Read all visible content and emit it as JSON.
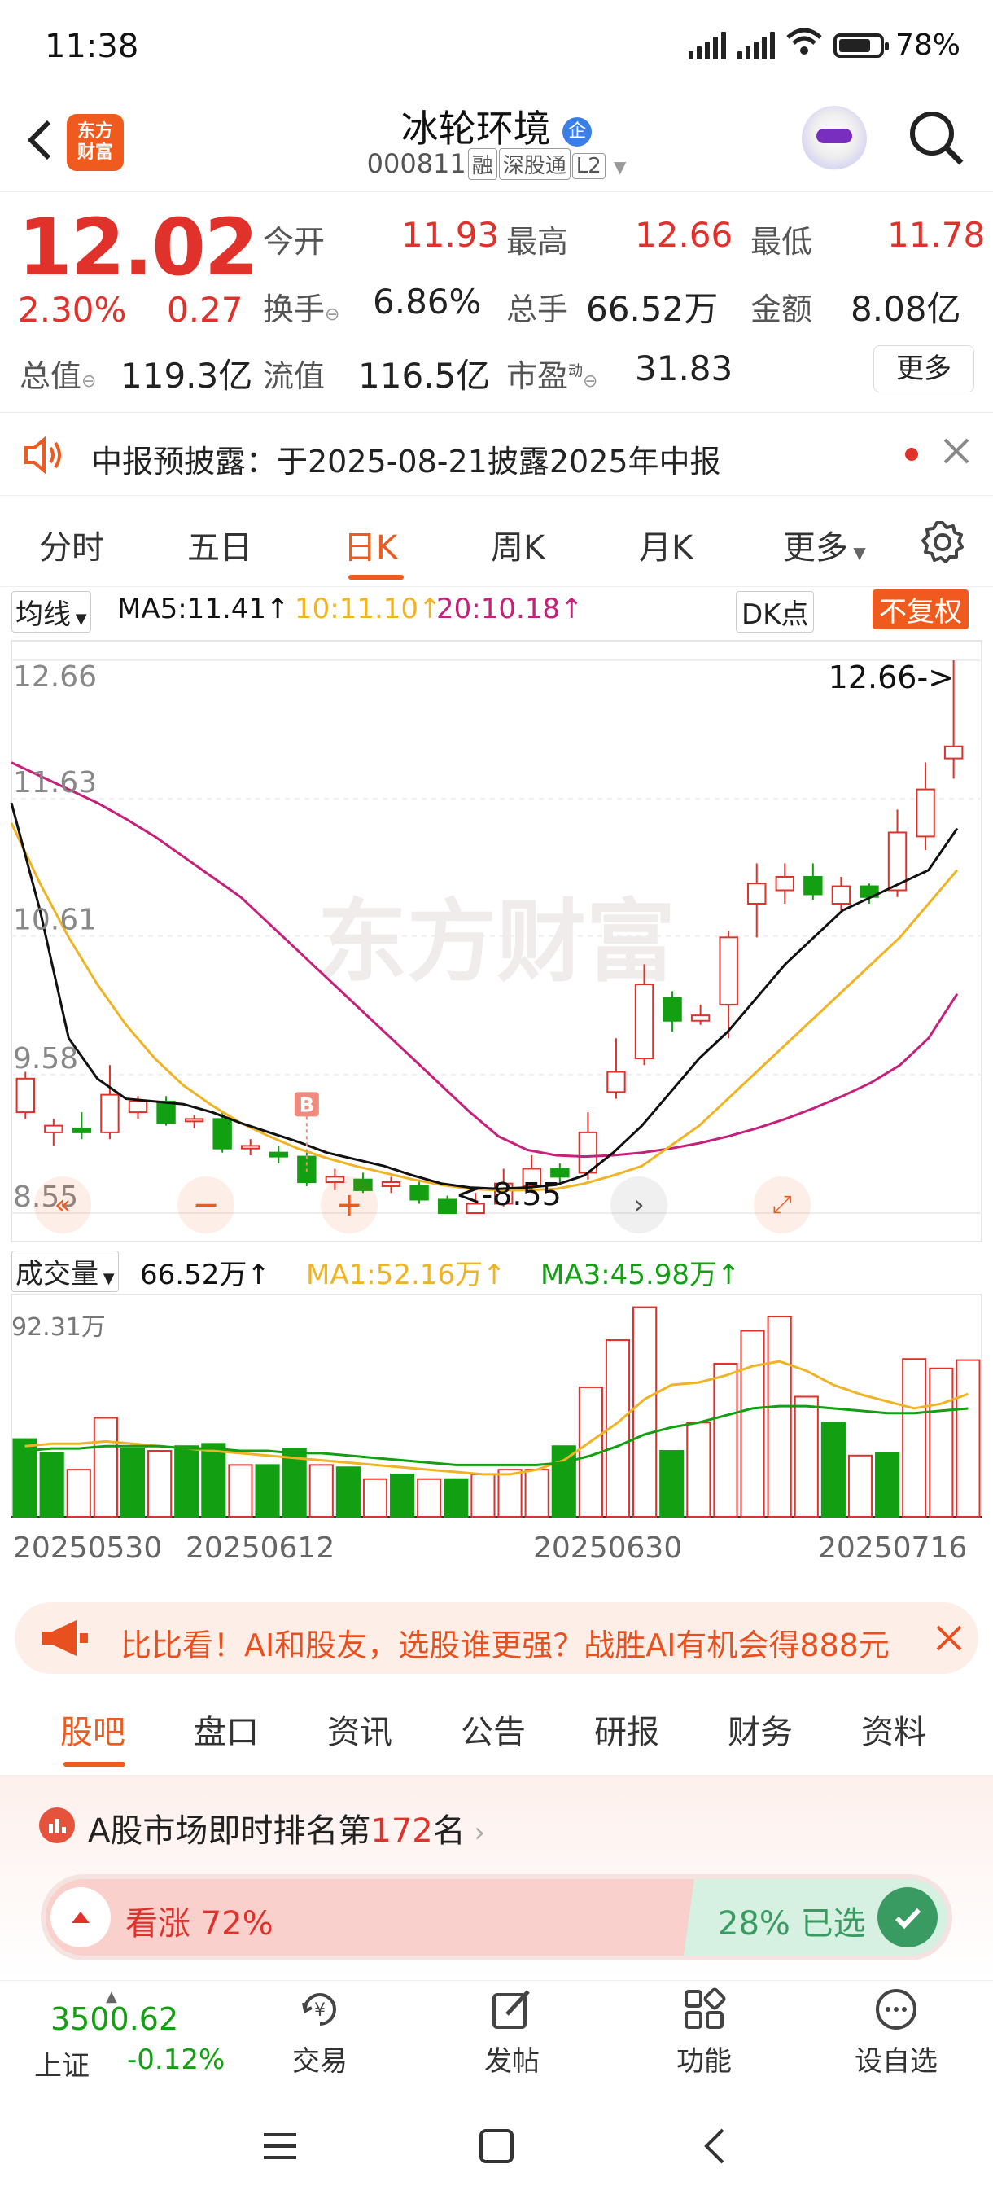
{
  "status_bar": {
    "time": "11:38",
    "battery": "78%"
  },
  "header": {
    "logo_line1": "东方",
    "logo_line2": "财富",
    "stock_name": "冰轮环境",
    "stock_badge": "企",
    "stock_code": "000811",
    "tags": [
      "融",
      "深股通",
      "L2"
    ]
  },
  "quote": {
    "price": "12.02",
    "change_pct": "2.30%",
    "change": "0.27",
    "open_label": "今开",
    "open": "11.93",
    "high_label": "最高",
    "high": "12.66",
    "low_label": "最低",
    "low": "11.78",
    "turnover_label": "换手",
    "turnover": "6.86%",
    "volume_label": "总手",
    "volume": "66.52万",
    "amount_label": "金额",
    "amount": "8.08亿",
    "mktcap_label": "总值",
    "mktcap": "119.3亿",
    "float_label": "流值",
    "float": "116.5亿",
    "pe_label": "市盈",
    "pe_sup": "动",
    "pe": "31.83",
    "more": "更多"
  },
  "notice": {
    "text": "中报预披露：于2025-08-21披露2025年中报"
  },
  "k_tabs": [
    "分时",
    "五日",
    "日K",
    "周K",
    "月K",
    "更多"
  ],
  "k_tab_active": "日K",
  "ma_row": {
    "selector": "均线",
    "ma5": "MA5:11.41",
    "ma10": "10:11.10",
    "ma20": "20:10.18",
    "dk": "DK点",
    "adjust": "不复权"
  },
  "vol_row": {
    "selector": "成交量",
    "vol": "66.52万",
    "ma1": "MA1:52.16万",
    "ma3": "MA3:45.98万",
    "vol_max": "92.31万"
  },
  "colors": {
    "up": "#e0312a",
    "down": "#12a012",
    "ma5": "#111111",
    "ma10": "#f0b323",
    "ma20": "#c6207a",
    "accent": "#ef5a1f"
  },
  "chart_data": {
    "type": "candlestick",
    "title": "",
    "price_ticks": [
      "12.66",
      "11.63",
      "10.61",
      "9.58",
      "8.55"
    ],
    "ylim": [
      8.55,
      12.66
    ],
    "high_marker": "12.66->",
    "low_marker": "<-8.55",
    "buy_marker": "B",
    "date_labels": [
      "20250530",
      "20250612",
      "20250630",
      "20250716"
    ],
    "candles": [
      {
        "o": 9.3,
        "c": 9.55,
        "h": 9.6,
        "l": 9.25
      },
      {
        "o": 9.15,
        "c": 9.2,
        "h": 9.25,
        "l": 9.05
      },
      {
        "o": 9.18,
        "c": 9.15,
        "h": 9.3,
        "l": 9.1
      },
      {
        "o": 9.15,
        "c": 9.43,
        "h": 9.65,
        "l": 9.1
      },
      {
        "o": 9.3,
        "c": 9.38,
        "h": 9.42,
        "l": 9.25
      },
      {
        "o": 9.38,
        "c": 9.22,
        "h": 9.42,
        "l": 9.2
      },
      {
        "o": 9.25,
        "c": 9.25,
        "h": 9.28,
        "l": 9.18
      },
      {
        "o": 9.25,
        "c": 9.03,
        "h": 9.3,
        "l": 9.0
      },
      {
        "o": 9.03,
        "c": 9.05,
        "h": 9.1,
        "l": 8.98
      },
      {
        "o": 9.0,
        "c": 8.97,
        "h": 9.05,
        "l": 8.92
      },
      {
        "o": 8.97,
        "c": 8.78,
        "h": 9.0,
        "l": 8.75
      },
      {
        "o": 8.78,
        "c": 8.82,
        "h": 8.88,
        "l": 8.72
      },
      {
        "o": 8.8,
        "c": 8.72,
        "h": 8.85,
        "l": 8.7
      },
      {
        "o": 8.75,
        "c": 8.78,
        "h": 8.82,
        "l": 8.7
      },
      {
        "o": 8.75,
        "c": 8.65,
        "h": 8.8,
        "l": 8.62
      },
      {
        "o": 8.65,
        "c": 8.55,
        "h": 8.68,
        "l": 8.55
      },
      {
        "o": 8.55,
        "c": 8.62,
        "h": 8.7,
        "l": 8.55
      },
      {
        "o": 8.62,
        "c": 8.77,
        "h": 8.88,
        "l": 8.6
      },
      {
        "o": 8.75,
        "c": 8.88,
        "h": 8.98,
        "l": 8.7
      },
      {
        "o": 8.88,
        "c": 8.82,
        "h": 8.92,
        "l": 8.78
      },
      {
        "o": 8.85,
        "c": 9.15,
        "h": 9.3,
        "l": 8.8
      },
      {
        "o": 9.45,
        "c": 9.6,
        "h": 9.85,
        "l": 9.4
      },
      {
        "o": 9.7,
        "c": 10.25,
        "h": 10.4,
        "l": 9.65
      },
      {
        "o": 10.15,
        "c": 9.98,
        "h": 10.2,
        "l": 9.9
      },
      {
        "o": 9.98,
        "c": 10.02,
        "h": 10.1,
        "l": 9.95
      },
      {
        "o": 10.1,
        "c": 10.6,
        "h": 10.65,
        "l": 9.85
      },
      {
        "o": 10.85,
        "c": 11.0,
        "h": 11.15,
        "l": 10.6
      },
      {
        "o": 10.95,
        "c": 11.05,
        "h": 11.15,
        "l": 10.85
      },
      {
        "o": 11.05,
        "c": 10.92,
        "h": 11.15,
        "l": 10.88
      },
      {
        "o": 10.85,
        "c": 10.98,
        "h": 11.05,
        "l": 10.8
      },
      {
        "o": 10.98,
        "c": 10.9,
        "h": 11.0,
        "l": 10.85
      },
      {
        "o": 10.95,
        "c": 11.38,
        "h": 11.55,
        "l": 10.9
      },
      {
        "o": 11.35,
        "c": 11.7,
        "h": 11.9,
        "l": 11.25
      },
      {
        "o": 11.93,
        "c": 12.02,
        "h": 12.66,
        "l": 11.78
      }
    ],
    "ma5": [
      11.6,
      10.8,
      9.85,
      9.55,
      9.4,
      9.38,
      9.36,
      9.3,
      9.22,
      9.15,
      9.08,
      9.0,
      8.95,
      8.9,
      8.83,
      8.77,
      8.74,
      8.73,
      8.74,
      8.76,
      8.83,
      9.0,
      9.2,
      9.45,
      9.7,
      9.9,
      10.15,
      10.4,
      10.6,
      10.8,
      10.9,
      11.0,
      11.1,
      11.41
    ],
    "ma10": [
      11.45,
      11.0,
      10.6,
      10.25,
      9.95,
      9.7,
      9.5,
      9.35,
      9.22,
      9.12,
      9.03,
      8.96,
      8.9,
      8.85,
      8.8,
      8.76,
      8.73,
      8.72,
      8.72,
      8.73,
      8.77,
      8.83,
      8.9,
      9.05,
      9.2,
      9.4,
      9.6,
      9.8,
      10.0,
      10.2,
      10.4,
      10.6,
      10.85,
      11.1
    ],
    "ma20": [
      11.9,
      11.8,
      11.7,
      11.6,
      11.48,
      11.35,
      11.2,
      11.05,
      10.9,
      10.7,
      10.5,
      10.3,
      10.1,
      9.9,
      9.7,
      9.5,
      9.3,
      9.12,
      9.02,
      8.98,
      8.97,
      8.98,
      9.0,
      9.03,
      9.07,
      9.12,
      9.18,
      9.25,
      9.33,
      9.42,
      9.52,
      9.65,
      9.85,
      10.18
    ],
    "volume": [
      33,
      27,
      20,
      42,
      29,
      28,
      30,
      31,
      22,
      22,
      29,
      22,
      21,
      16,
      18,
      16,
      16,
      18,
      20,
      20,
      30,
      55,
      75,
      89,
      28,
      40,
      65,
      79,
      85,
      51,
      40,
      26,
      27,
      67,
      63,
      66.52
    ],
    "volume_up": [
      false,
      false,
      true,
      true,
      false,
      true,
      false,
      false,
      true,
      false,
      false,
      true,
      false,
      true,
      false,
      true,
      false,
      true,
      true,
      true,
      false,
      true,
      true,
      true,
      false,
      true,
      true,
      true,
      true,
      true,
      false,
      true,
      false,
      true,
      true,
      true
    ],
    "vol_ma1": [
      30,
      31,
      31,
      32,
      31,
      30,
      29,
      28,
      27,
      26,
      25,
      24,
      23,
      22,
      21,
      20,
      19,
      18,
      18,
      20,
      24,
      32,
      40,
      50,
      56,
      57,
      60,
      64,
      66,
      62,
      56,
      52,
      49,
      46,
      48,
      52.16
    ],
    "vol_ma3": [
      28,
      29,
      29,
      30,
      30,
      30,
      29,
      29,
      28,
      28,
      27,
      27,
      26,
      25,
      24,
      23,
      22,
      22,
      22,
      22,
      23,
      26,
      30,
      35,
      38,
      40,
      43,
      46,
      47,
      47,
      46,
      45,
      44,
      44,
      45,
      45.98
    ]
  },
  "promo": {
    "text": "比比看！AI和股友，选股谁更强？战胜AI有机会得888元"
  },
  "post_tabs": [
    "股吧",
    "盘口",
    "资讯",
    "公告",
    "研报",
    "财务",
    "资料"
  ],
  "rank": {
    "prefix": "A股市场即时排名第",
    "rank": "172",
    "suffix": "名"
  },
  "vote": {
    "up_label": "看涨",
    "up_pct": "72%",
    "down_pct": "28%",
    "chosen": "已选"
  },
  "index": {
    "value": "3500.62",
    "name": "上证",
    "change": "-0.12%"
  },
  "bottom_tools": [
    "交易",
    "发帖",
    "功能",
    "设自选"
  ]
}
